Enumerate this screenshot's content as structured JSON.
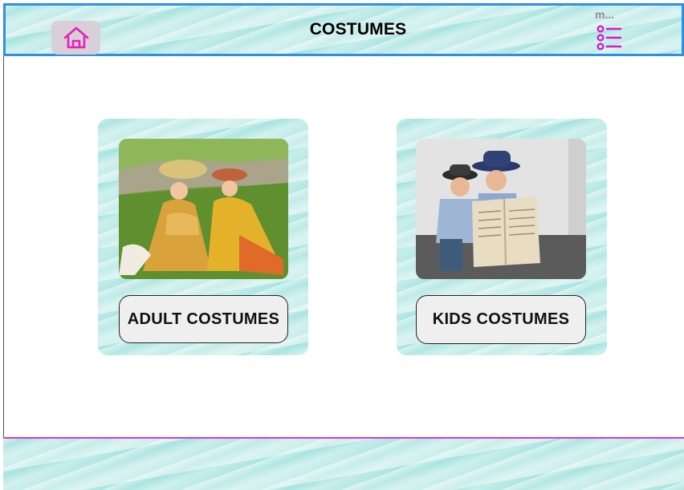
{
  "header": {
    "title": "COSTUMES",
    "menu_text": "m...",
    "home_icon": "home-icon",
    "menu_icon": "list-menu-icon"
  },
  "cards": [
    {
      "label": "ADULT COSTUMES",
      "image": "adult-costumes-photo"
    },
    {
      "label": "KIDS COSTUMES",
      "image": "kids-costumes-photo"
    }
  ],
  "colors": {
    "header_border": "#2f8fe8",
    "accent_magenta": "#d63ad0",
    "water": "#c7ece9",
    "button_bg": "#efefef"
  }
}
